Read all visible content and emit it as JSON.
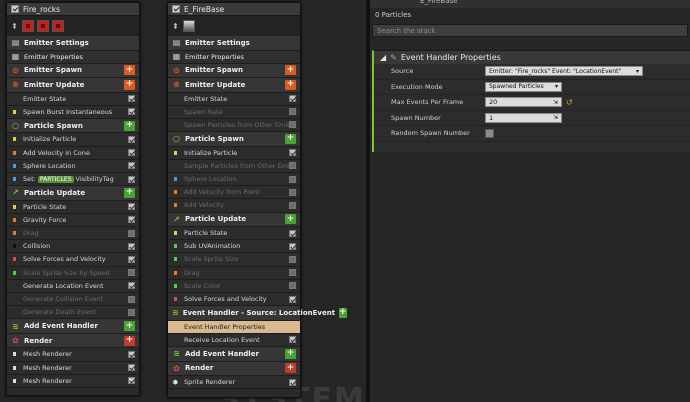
{
  "emitter1": {
    "title": "Fire_rocks",
    "rows": [
      {
        "kind": "sec",
        "icon": "settings-icon",
        "label": "Emitter Settings"
      },
      {
        "kind": "sub",
        "icon": "cpu-icon",
        "label": "Emitter Properties"
      },
      {
        "kind": "sec",
        "icon": "spawn-icon",
        "label": "Emitter Spawn",
        "btn": "+",
        "btncolor": "orange"
      },
      {
        "kind": "sec",
        "icon": "update-icon",
        "label": "Emitter Update",
        "btn": "+",
        "btncolor": "orange"
      },
      {
        "kind": "row",
        "label": "Emitter State",
        "on": true
      },
      {
        "kind": "row",
        "label": "Spawn Burst Instantaneous",
        "on": true,
        "mark": "#e6c84a"
      },
      {
        "kind": "sec",
        "icon": "particle-spawn-icon",
        "label": "Particle Spawn",
        "btn": "+"
      },
      {
        "kind": "row",
        "label": "Initialize Particle",
        "on": true,
        "mark": "#e6c84a"
      },
      {
        "kind": "row",
        "label": "Add Velocity in Cone",
        "on": true,
        "mark": "#e67c2a"
      },
      {
        "kind": "row",
        "label": "Sphere Location",
        "on": true,
        "mark": "#4a9ae6"
      },
      {
        "kind": "tagrow",
        "prefix": "Set:",
        "tag": "PARTICLES",
        "suffix": "VisibilityTag",
        "on": true,
        "mark": "#4a9ae6"
      },
      {
        "kind": "sec",
        "icon": "particle-update-icon",
        "label": "Particle Update",
        "btn": "+"
      },
      {
        "kind": "row",
        "label": "Particle State",
        "on": true,
        "mark": "#e6c84a"
      },
      {
        "kind": "row",
        "label": "Gravity Force",
        "on": true,
        "mark": "#e67c2a"
      },
      {
        "kind": "row",
        "label": "Drag",
        "on": false,
        "dim": true,
        "mark": "#e67c2a"
      },
      {
        "kind": "row",
        "label": "Collision",
        "on": true,
        "mark": "#111111"
      },
      {
        "kind": "row",
        "label": "Solve Forces and Velocity",
        "on": true,
        "mark": "#e04a4a"
      },
      {
        "kind": "row",
        "label": "Scale Sprite Size by Speed",
        "on": false,
        "dim": true,
        "mark": "#4ad04a"
      },
      {
        "kind": "row",
        "label": "Generate Location Event",
        "on": true
      },
      {
        "kind": "row",
        "label": "Generate Collision Event",
        "on": false,
        "dim": true
      },
      {
        "kind": "row",
        "label": "Generate Death Event",
        "on": false,
        "dim": true
      },
      {
        "kind": "sec",
        "icon": "event-handler-icon",
        "label": "Add Event Handler",
        "btn": "+"
      },
      {
        "kind": "sec",
        "icon": "render-icon",
        "label": "Render",
        "btn": "+",
        "btncolor": "red"
      },
      {
        "kind": "row",
        "label": "Mesh Renderer",
        "on": true,
        "mark": "#dddddd"
      },
      {
        "kind": "row",
        "label": "Mesh Renderer",
        "on": true,
        "mark": "#dddddd"
      },
      {
        "kind": "row",
        "label": "Mesh Renderer",
        "on": true,
        "mark": "#dddddd"
      }
    ]
  },
  "emitter2": {
    "title": "E_FireBase",
    "rows": [
      {
        "kind": "sec",
        "icon": "settings-icon",
        "label": "Emitter Settings"
      },
      {
        "kind": "sub",
        "icon": "cpu-icon",
        "label": "Emitter Properties"
      },
      {
        "kind": "sec",
        "icon": "spawn-icon",
        "label": "Emitter Spawn",
        "btn": "+",
        "btncolor": "orange"
      },
      {
        "kind": "sec",
        "icon": "update-icon",
        "label": "Emitter Update",
        "btn": "+",
        "btncolor": "orange"
      },
      {
        "kind": "row",
        "label": "Emitter State",
        "on": true
      },
      {
        "kind": "row",
        "label": "Spawn Rate",
        "on": false,
        "dim": true
      },
      {
        "kind": "row",
        "label": "Spawn Particles from Other Emitter",
        "on": false,
        "dim": true
      },
      {
        "kind": "sec",
        "icon": "particle-spawn-icon",
        "label": "Particle Spawn",
        "btn": "+"
      },
      {
        "kind": "row",
        "label": "Initialize Particle",
        "on": true,
        "mark": "#e6c84a"
      },
      {
        "kind": "row",
        "label": "Sample Particles from Other Emitter",
        "on": false,
        "dim": true
      },
      {
        "kind": "row",
        "label": "Sphere Location",
        "on": false,
        "dim": true,
        "mark": "#4a9ae6"
      },
      {
        "kind": "row",
        "label": "Add Velocity from Point",
        "on": false,
        "dim": true,
        "mark": "#e67c2a"
      },
      {
        "kind": "row",
        "label": "Add Velocity",
        "on": false,
        "dim": true,
        "mark": "#e67c2a"
      },
      {
        "kind": "sec",
        "icon": "particle-update-icon",
        "label": "Particle Update",
        "btn": "+"
      },
      {
        "kind": "row",
        "label": "Particle State",
        "on": true,
        "mark": "#e6c84a"
      },
      {
        "kind": "row",
        "label": "Sub UVAnimation",
        "on": true,
        "mark": "#4ad04a"
      },
      {
        "kind": "row",
        "label": "Scale Sprite Size",
        "on": false,
        "dim": true,
        "mark": "#4ad04a"
      },
      {
        "kind": "row",
        "label": "Drag",
        "on": false,
        "dim": true,
        "mark": "#e67c2a"
      },
      {
        "kind": "row",
        "label": "Scale Color",
        "on": false,
        "dim": true,
        "mark": "#4ad04a"
      },
      {
        "kind": "row",
        "label": "Solve Forces and Velocity",
        "on": true,
        "mark": "#e04a4a"
      },
      {
        "kind": "sec",
        "icon": "event-handler-icon",
        "label": "Event Handler - Source: LocationEvent",
        "btn": "+"
      },
      {
        "kind": "row",
        "label": "Event Handler Properties",
        "sel": true
      },
      {
        "kind": "row",
        "label": "Receive Location Event",
        "on": true
      },
      {
        "kind": "sec",
        "icon": "event-handler-icon",
        "label": "Add Event Handler",
        "btn": "+"
      },
      {
        "kind": "sec",
        "icon": "render-icon",
        "label": "Render",
        "btn": "+",
        "btncolor": "red"
      },
      {
        "kind": "row",
        "label": "Sprite Renderer",
        "on": true,
        "mark": "#dddddd",
        "icon": "sprite-icon"
      }
    ]
  },
  "watermark": "SYSTEM",
  "panel": {
    "header": "E_FireBase",
    "particles": "0 Particles",
    "search_placeholder": "Search the stack",
    "section_title": "Event Handler Properties",
    "props": [
      {
        "label": "Source",
        "type": "dropdown",
        "value": "Emitter: \"Fire_rocks\" Event: \"LocationEvent\""
      },
      {
        "label": "Execution Mode",
        "type": "dropdown",
        "value": "Spawned Particles"
      },
      {
        "label": "Max Events Per Frame",
        "type": "number",
        "value": "20",
        "reset": true
      },
      {
        "label": "Spawn Number",
        "type": "number",
        "value": "1"
      },
      {
        "label": "Random Spawn Number",
        "type": "checkbox",
        "value": "false"
      }
    ]
  },
  "colors": {
    "accent_green": "#7cc629",
    "add_green": "#47a332",
    "add_orange": "#e05a20",
    "add_red": "#c23a2a",
    "selected": "#d9b98f"
  }
}
